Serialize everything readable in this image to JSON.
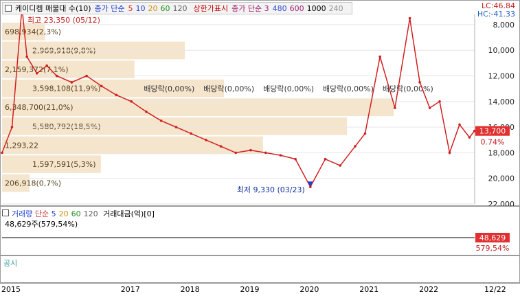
{
  "price_panel": {
    "legend": {
      "stock": "케이디켐 매물대 수(10)",
      "ma_title": "종가 단순",
      "ma_periods": [
        "5",
        "10",
        "20",
        "60",
        "120"
      ],
      "ma_colors": [
        "#d02020",
        "#2040d0",
        "#d09010",
        "#209020",
        "#606060"
      ],
      "limit_label": "상한가표시",
      "ma3_title": "종가 단순 3",
      "ma3_periods": [
        "480",
        "600",
        "1000",
        "240"
      ],
      "ma3_colors": [
        "#3050d0",
        "#a02070",
        "#000000",
        "#909090"
      ]
    },
    "lc": "LC:46.84",
    "hc": "HC:-41.33",
    "high_label": "최고 23,350 (05/12)",
    "low_label": "최저 9,330 (03/23)",
    "current_price": "13,700",
    "current_change": "0.74%",
    "price_axis_ticks": [
      "22,000",
      "20,000",
      "18,000",
      "16,000",
      "14,000",
      "12,000",
      "10,000",
      "8,000"
    ]
  },
  "volume_panel": {
    "title": "거래량",
    "ma_title": "단순",
    "ma_periods": [
      "5",
      "20",
      "60",
      "120"
    ],
    "ma_colors": [
      "#2040d0",
      "#d09010",
      "#209020",
      "#606060"
    ],
    "amount_title": "거래대금(억)[0]",
    "volume_label": "48,629주(579,54%)",
    "current_volume": "48,629",
    "current_ratio": "579,54%"
  },
  "notice_panel": {
    "title": "공시"
  },
  "time_axis": {
    "labels": [
      "2015",
      "2017",
      "2018",
      "2019",
      "2020",
      "2021",
      "2022",
      "12/22"
    ]
  },
  "chart_data": {
    "type": "line",
    "title": "케이디켐 매물대 수(10)",
    "xlabel": "",
    "ylabel": "",
    "ylim": [
      8000,
      22800
    ],
    "y_ticks": [
      8000,
      10000,
      12000,
      14000,
      16000,
      18000,
      20000,
      22000
    ],
    "x": [
      "2015-01",
      "2015-03",
      "2015-05",
      "2015-06",
      "2015-08",
      "2015-10",
      "2015-12",
      "2016-03",
      "2016-06",
      "2016-09",
      "2016-12",
      "2017-03",
      "2017-06",
      "2017-09",
      "2017-12",
      "2018-03",
      "2018-06",
      "2018-09",
      "2018-12",
      "2019-03",
      "2019-06",
      "2019-09",
      "2019-12",
      "2020-03",
      "2020-06",
      "2020-09",
      "2020-12",
      "2021-02",
      "2021-05",
      "2021-08",
      "2021-11",
      "2022-01",
      "2022-03",
      "2022-05",
      "2022-07",
      "2022-09",
      "2022-11",
      "2022-12"
    ],
    "series": [
      {
        "name": "",
        "color": "#d02020",
        "values": [
          12000,
          14000,
          23350,
          19500,
          18200,
          18800,
          18000,
          17500,
          18000,
          17200,
          16500,
          16000,
          15200,
          14500,
          14000,
          13500,
          13000,
          12500,
          12000,
          12200,
          12000,
          11800,
          11500,
          9330,
          11500,
          11000,
          12500,
          13500,
          19500,
          15500,
          22500,
          17500,
          15500,
          16000,
          12000,
          14200,
          13200,
          13700
        ]
      }
    ],
    "volume_profile": [
      {
        "label": "206,918(0,7%)",
        "pct": 0.7
      },
      {
        "label": "1,597,591(5,3%)",
        "pct": 5.3
      },
      {
        "label": "1,293,22",
        "pct": null
      },
      {
        "label": "5,580,792(18,5%)",
        "pct": 18.5
      },
      {
        "label": "6,348,700(21,0%)",
        "pct": 21.0
      },
      {
        "label": "3,598,108(11,9%)",
        "pct": 11.9
      },
      {
        "label": "2,159,372(7,1%)",
        "pct": 7.1
      },
      {
        "label": "2,969,918(9,8%)",
        "pct": 9.8
      },
      {
        "label": "698,934(2,3%)",
        "pct": 2.3
      }
    ],
    "dividend_marks": [
      {
        "label": "배당락(0,00%)",
        "date": "2017-12"
      },
      {
        "label": "배당락(0,00%)",
        "date": "2018-12"
      },
      {
        "label": "배당락(0,00%)",
        "date": "2019-12"
      },
      {
        "label": "배당락(0,00%)",
        "date": "2020-12"
      },
      {
        "label": "배당락(0,00%)",
        "date": "2021-12"
      }
    ]
  }
}
